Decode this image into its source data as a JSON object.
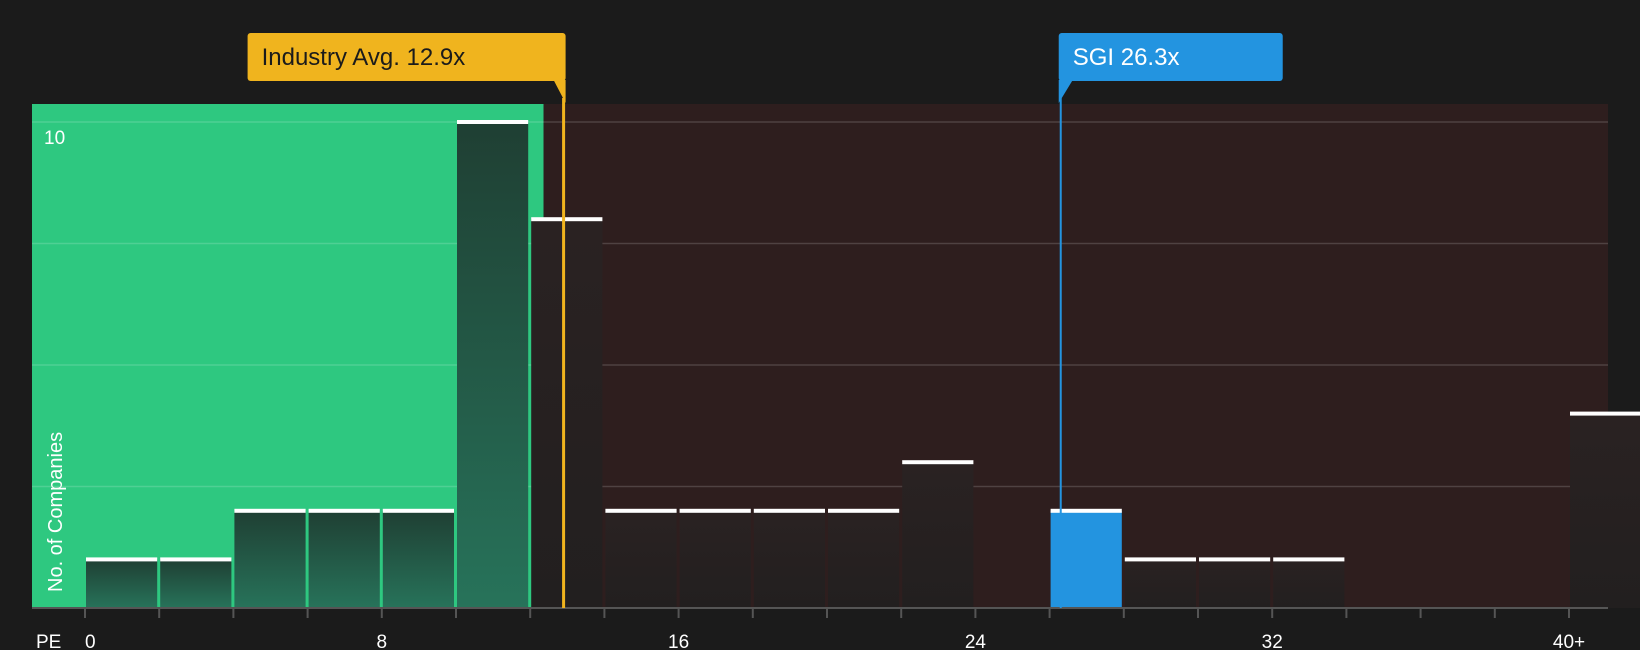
{
  "chart_data": {
    "type": "bar",
    "title": "",
    "xlabel": "PE",
    "ylabel": "No. of Companies",
    "x_ticks": [
      "0",
      "8",
      "16",
      "24",
      "32",
      "40+"
    ],
    "y_ticks": [
      "10"
    ],
    "ylim": [
      0,
      10
    ],
    "grid": true,
    "bin_width": 2,
    "bins": [
      {
        "x0": 0,
        "value": 1,
        "highlight": false
      },
      {
        "x0": 2,
        "value": 1,
        "highlight": false
      },
      {
        "x0": 4,
        "value": 2,
        "highlight": false
      },
      {
        "x0": 6,
        "value": 2,
        "highlight": false
      },
      {
        "x0": 8,
        "value": 2,
        "highlight": false
      },
      {
        "x0": 10,
        "value": 10,
        "highlight": false
      },
      {
        "x0": 12,
        "value": 8,
        "highlight": false
      },
      {
        "x0": 14,
        "value": 2,
        "highlight": false
      },
      {
        "x0": 16,
        "value": 2,
        "highlight": false
      },
      {
        "x0": 18,
        "value": 2,
        "highlight": false
      },
      {
        "x0": 20,
        "value": 2,
        "highlight": false
      },
      {
        "x0": 22,
        "value": 3,
        "highlight": false
      },
      {
        "x0": 26,
        "value": 2,
        "highlight": true
      },
      {
        "x0": 28,
        "value": 1,
        "highlight": false
      },
      {
        "x0": 30,
        "value": 1,
        "highlight": false
      },
      {
        "x0": 32,
        "value": 1,
        "highlight": false
      },
      {
        "x0": 40,
        "value": 4,
        "highlight": false
      }
    ],
    "markers": [
      {
        "name": "industry-avg",
        "label": "Industry Avg. 12.9x",
        "value": 12.9,
        "color": "#f0b41e"
      },
      {
        "name": "sgi",
        "label": "SGI 26.3x",
        "value": 26.3,
        "color": "#2394e0"
      }
    ],
    "colors": {
      "background": "#1b1b1b",
      "undervalued_zone": "#2ec880",
      "overvalued_zone": "#2e1e1e",
      "bar": "#262626",
      "highlight_bar": "#2394e0",
      "bar_cap": "#ffffff"
    }
  }
}
